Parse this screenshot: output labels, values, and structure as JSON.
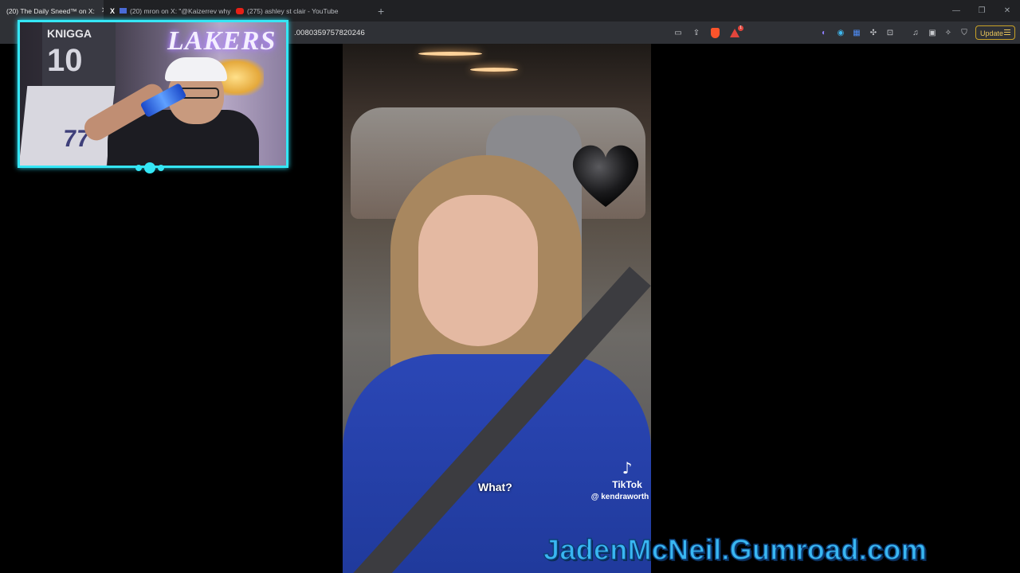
{
  "tabs": [
    {
      "title": "(20) The Daily Sneed™ on X:",
      "favicon": "x-icon",
      "active": true
    },
    {
      "title": "(20) mron on X: \"@Kaizerrev why",
      "favicon": "x-icon",
      "active": false
    },
    {
      "title": "(275) ashley st clair - YouTube",
      "favicon": "youtube-icon",
      "active": false
    }
  ],
  "address_bar": {
    "url_fragment": ".0080359757820246"
  },
  "toolbar": {
    "update_label": "Update",
    "notification_count": "1"
  },
  "webcam": {
    "jersey_name": "KNIGGA",
    "jersey_number": "10",
    "jersey_number_2": "77",
    "neon_sign": "LAKERS"
  },
  "video": {
    "caption": "What?",
    "tiktok_brand": "TikTok",
    "tiktok_handle": "@ kendraworth"
  },
  "watermark": "JadenMcNeil.Gumroad.com",
  "colors": {
    "overlay_accent": "#35e6f5",
    "watermark": "#39b7f2",
    "brave": "#fb542b"
  }
}
